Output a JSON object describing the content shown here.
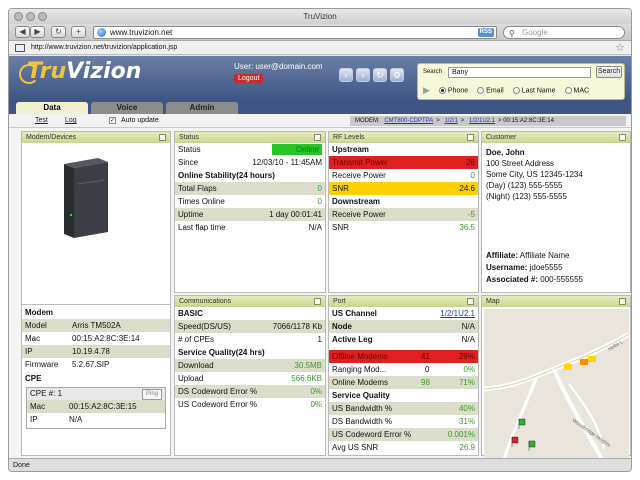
{
  "browser": {
    "title": "TruVizion",
    "url": "www.truvizion.net",
    "page_url": "http://www.truvizion.net/truvizion/application.jsp",
    "rss": "RSS",
    "search_placeholder": "Google",
    "status": "Done"
  },
  "app": {
    "logo_main": "Tru",
    "logo_accent": "Vizion",
    "user": "User: user@domain.com",
    "logout": "Logout",
    "search": {
      "label": "Search",
      "value": "Bany",
      "button": "Search",
      "options": [
        "Phone",
        "Email",
        "Last Name",
        "MAC"
      ],
      "selected": "Phone"
    },
    "tabs": [
      "Data",
      "Voice",
      "Admin"
    ],
    "active_tab": "Data",
    "subnav": {
      "test": "Test",
      "log": "Log",
      "auto_update": "Auto update"
    },
    "modem_path": {
      "prefix": "MODEM:",
      "cm": "CMT800-CDPTPA",
      "arrow1": ">",
      "slot": "1/2/1",
      "arrow2": ">",
      "port": "1/2/1U2.1",
      "arrow3": ">",
      "mac": "00:15:A2:8C:3E:14"
    }
  },
  "modem_devices": {
    "title": "Modem/Devices",
    "modem_title": "Modem",
    "rows": [
      {
        "k": "Model",
        "v": "Arris TM502A"
      },
      {
        "k": "Mac",
        "v": "00:15:A2:8C:3E:14"
      },
      {
        "k": "IP",
        "v": "10.19.4.78"
      },
      {
        "k": "Firmware",
        "v": "5.2.67.SIP"
      }
    ],
    "cpe_title": "CPE",
    "cpe_label": "CPE #: 1",
    "ping": "Ping",
    "cpe_rows": [
      {
        "k": "Mac",
        "v": "00:15:A2:8C:3E:15"
      },
      {
        "k": "IP",
        "v": "N/A"
      }
    ]
  },
  "status": {
    "title": "Status",
    "status_label": "Status",
    "status_value": "Online",
    "since_label": "Since",
    "since_value": "12/03/10 - 11:45AM",
    "stability_title": "Online Stability(24 hours)",
    "rows": [
      {
        "k": "Total Flaps",
        "v": "0"
      },
      {
        "k": "Times Online",
        "v": "0"
      },
      {
        "k": "Uptime",
        "v": "1 day 00:01:41"
      },
      {
        "k": "Last flap time",
        "v": "N/A"
      }
    ]
  },
  "rf": {
    "title": "RF Levels",
    "upstream": "Upstream",
    "up_rows": [
      {
        "k": "Transmit Power",
        "v": "26"
      },
      {
        "k": "Receive Power",
        "v": "0"
      },
      {
        "k": "SNR",
        "v": "24.6"
      }
    ],
    "downstream": "Downstream",
    "down_rows": [
      {
        "k": "Receive Power",
        "v": "-5"
      },
      {
        "k": "SNR",
        "v": "36.5"
      }
    ]
  },
  "customer": {
    "title": "Customer",
    "name": "Doe, John",
    "street": "100 Street Address",
    "city": "Some City, US 12345-1234",
    "day": "(Day) (123) 555-5555",
    "night": "(Night) (123) 555-5555",
    "affiliate_label": "Affiliate:",
    "affiliate": "Affiliate Name",
    "username_label": "Username:",
    "username": "jdoe5555",
    "assoc_label": "Associated #:",
    "assoc": "000-555555"
  },
  "comms": {
    "title": "Communications",
    "basic": "BASIC",
    "speed_label": "Speed(DS/US)",
    "speed": "7066/1178 Kb",
    "cpes_label": "# of CPEs",
    "cpes": "1",
    "sq_title": "Service Quality(24 hrs)",
    "rows": [
      {
        "k": "Download",
        "v": "30.5MB"
      },
      {
        "k": "Upload",
        "v": "566.6KB"
      },
      {
        "k": "DS Codeword Error %",
        "v": "0%"
      },
      {
        "k": "US Codeword Error %",
        "v": "0%"
      }
    ]
  },
  "port": {
    "title": "Port",
    "us_channel_label": "US Channel",
    "us_channel": "1/2/1U2.1",
    "node_label": "Node",
    "node": "N/A",
    "active_leg_label": "Active Leg",
    "active_leg": "N/A",
    "offline_label": "Offline Modems",
    "offline_n": "41",
    "offline_pct": "29%",
    "ranging_label": "Ranging Mod...",
    "ranging_n": "0",
    "ranging_pct": "0%",
    "online_label": "Online Modems",
    "online_n": "98",
    "online_pct": "71%",
    "sq_title": "Service Quality",
    "sq_rows": [
      {
        "k": "US Bandwidth %",
        "v": "40%"
      },
      {
        "k": "DS Bandwidth %",
        "v": "31%"
      },
      {
        "k": "US Codeword Error %",
        "v": "0.001%"
      },
      {
        "k": "Avg US SNR",
        "v": "26.9"
      }
    ]
  },
  "map": {
    "title": "Map",
    "road1": "Woodbridge Heights",
    "road2": "Hollis L."
  },
  "colors": {
    "header": "#3e5585",
    "panel_head": "#d6dea6",
    "online": "#28c428",
    "alert_red": "#e02020",
    "alert_yellow": "#ffd000",
    "value_green": "#3a9a2a"
  }
}
